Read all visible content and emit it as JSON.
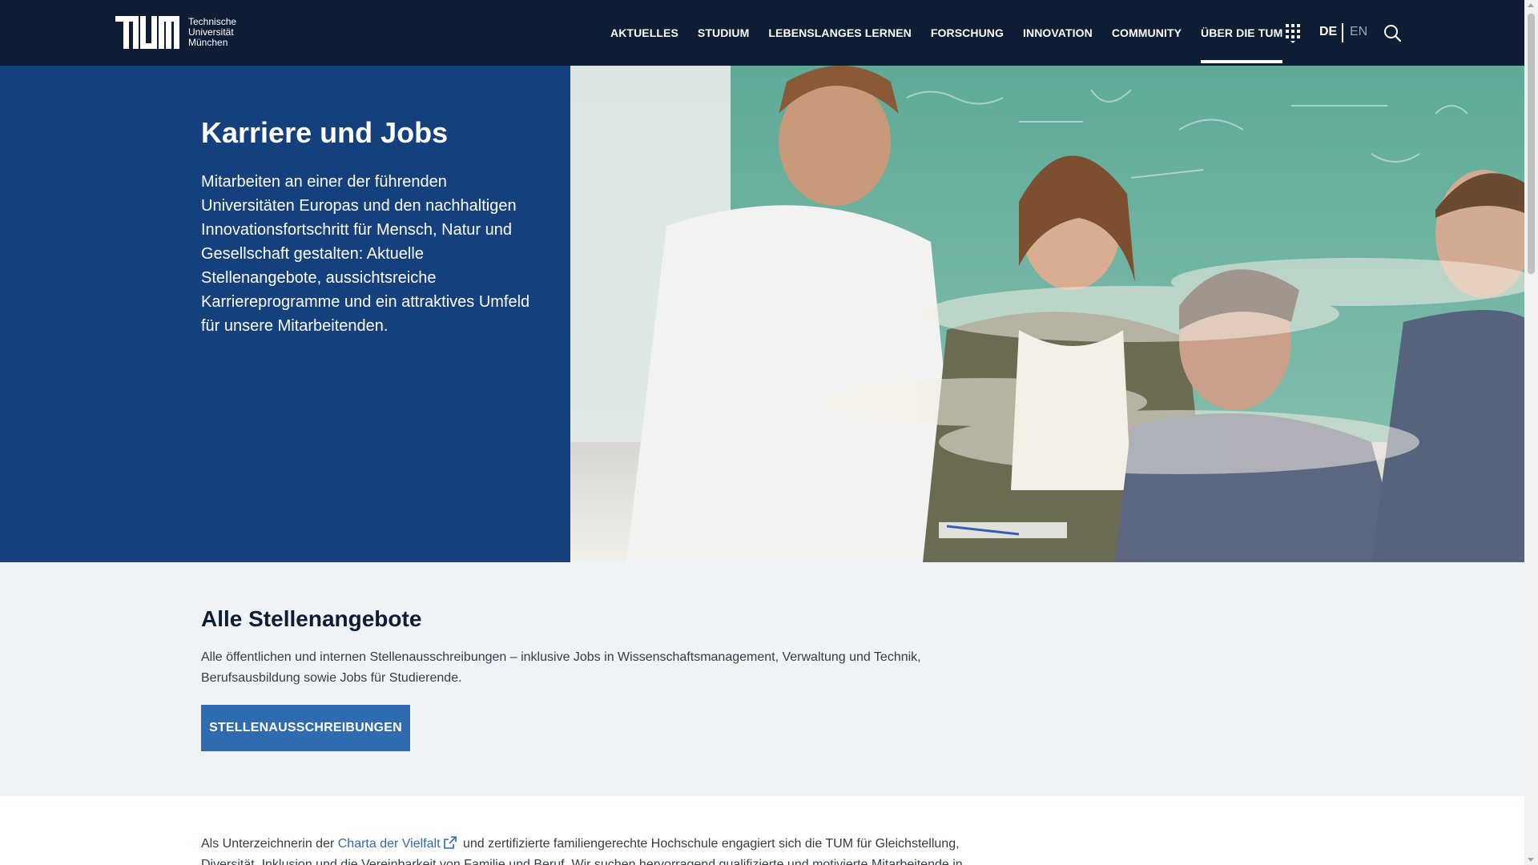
{
  "header": {
    "logo": {
      "line1": "Technische",
      "line2": "Universität",
      "line3": "München",
      "icon": "tum-logo"
    },
    "nav": [
      {
        "label": "AKTUELLES"
      },
      {
        "label": "STUDIUM"
      },
      {
        "label": "LEBENSLANGES LERNEN"
      },
      {
        "label": "FORSCHUNG"
      },
      {
        "label": "INNOVATION"
      },
      {
        "label": "COMMUNITY"
      },
      {
        "label": "ÜBER DIE TUM",
        "active": true
      }
    ],
    "apps_icon": "apps-grid-icon",
    "lang_de": "DE",
    "lang_en": "EN",
    "search_icon": "search-icon"
  },
  "hero": {
    "title": "Karriere und Jobs",
    "text": "Mitarbeiten an einer der führenden Universitäten Europas und den nachhaltigen Innovationsfortschritt für Mensch, Natur und Gesellschaft gestalten: Aktuelle Stellenangebote, aussichtsreiche Karriereprogramme und ein attraktives Umfeld für unsere Mitarbeitenden."
  },
  "jobs": {
    "title": "Alle Stellenangebote",
    "text": "Alle öffentlichen und internen Stellenausschreibungen – inklusive Jobs in Wissenschaftsmanagement, Verwaltung und Technik, Berufsausbildung sowie Jobs für Studierende.",
    "button": "STELLENAUSSCHREIBUNGEN"
  },
  "diversity": {
    "before": "Als Unterzeichnerin der",
    "link": "Charta der Vielfalt",
    "after": "und zertifizierte familiengerechte Hochschule engagiert sich die TUM für Gleichstellung, Diversität, Inklusion und die Vereinbarkeit von Familie und Beruf. Wir suchen hervorragend qualifizierte und motivierte Mitarbeitende in"
  },
  "colors": {
    "header_bg": "#0e1d33",
    "hero_blue": "#14407e",
    "button_blue": "#2f6bb1",
    "section_grey": "#eff3f6"
  }
}
